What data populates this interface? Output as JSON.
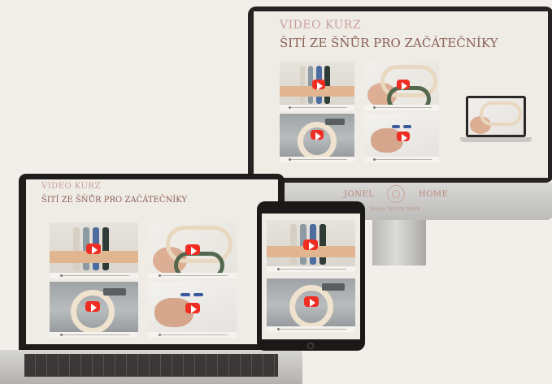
{
  "monitor": {
    "kicker": "VIDEO KURZ",
    "title": "ŠITÍ ZE ŠŇŮR PRO ZAČÁTEČNÍKY",
    "nav_left": "JONEL",
    "nav_right": "HOME",
    "footer_text": "ŠKOLA ŠITÍ ZE ŠŇŮR"
  },
  "laptop": {
    "kicker": "VIDEO KURZ",
    "title": "ŠITÍ ZE ŠŇŮR PRO ZAČÁTEČNÍKY"
  },
  "videos": [
    {
      "scene": "cords-on-strip",
      "icon": "play-icon"
    },
    {
      "scene": "hands-holding-rope",
      "icon": "play-icon"
    },
    {
      "scene": "sewing-machine-coil",
      "icon": "play-icon"
    },
    {
      "scene": "sewing-with-clips",
      "icon": "play-icon"
    }
  ],
  "colors": {
    "accent": "#c9a09a",
    "title": "#8a5e55",
    "play": "#ef2d23",
    "background": "#f2efea"
  }
}
